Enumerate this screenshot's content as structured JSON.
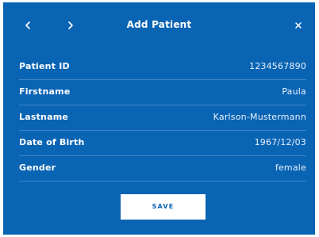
{
  "dialog": {
    "title": "Add Patient",
    "nav": {
      "prev_icon": "chevron-left-icon",
      "next_icon": "chevron-right-icon"
    },
    "close_icon": "close-icon",
    "colors": {
      "background": "#0a64b4",
      "text": "#ffffff",
      "divider": "#3f86c6",
      "button_bg": "#ffffff",
      "button_text": "#0a64b4"
    }
  },
  "fields": [
    {
      "label": "Patient ID",
      "value": "1234567890"
    },
    {
      "label": "Firstname",
      "value": "Paula"
    },
    {
      "label": "Lastname",
      "value": "Karlson-Mustermann"
    },
    {
      "label": "Date of Birth",
      "value": "1967/12/03"
    },
    {
      "label": "Gender",
      "value": "female"
    }
  ],
  "save_label": "SAVE"
}
